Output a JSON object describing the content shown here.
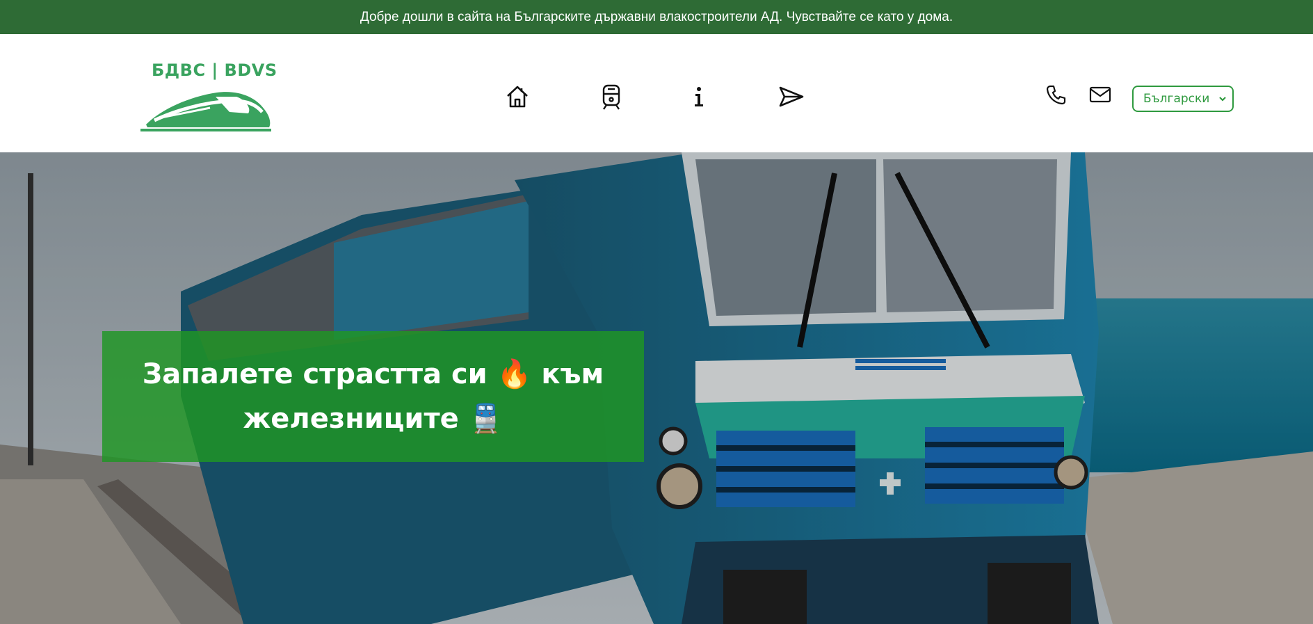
{
  "topbar": {
    "welcome_text": "Добре дошли в сайта на Българските държавни влакостроители АД. Чувствайте се като у дома."
  },
  "header": {
    "logo_text": "БДВС | BDVS",
    "nav": [
      {
        "icon": "home-icon"
      },
      {
        "icon": "train-icon"
      },
      {
        "icon": "info-icon"
      },
      {
        "icon": "send-icon"
      }
    ],
    "contact": [
      {
        "icon": "phone-icon"
      },
      {
        "icon": "mail-icon"
      }
    ],
    "language": {
      "selected": "Български"
    }
  },
  "hero": {
    "headline": "Запалете страстта си 🔥 към железниците 🚆"
  },
  "colors": {
    "topbar": "#2e6b35",
    "brand_green": "#3aa35f",
    "headline_box": "#1e9623"
  }
}
